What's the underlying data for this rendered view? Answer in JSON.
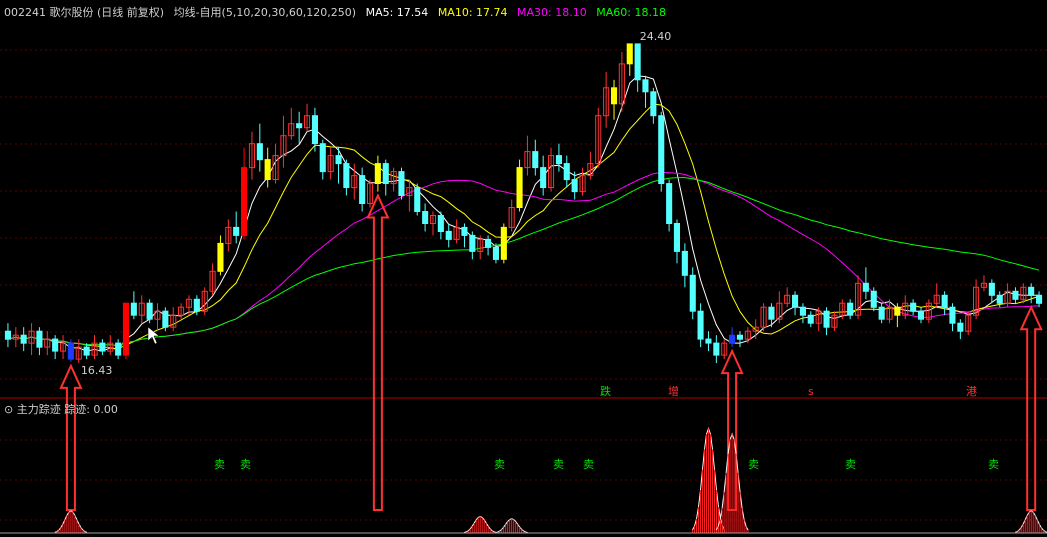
{
  "header": {
    "stock": "002241 歌尔股份 (日线 前复权)",
    "indicator": "均线-自用(5,10,20,30,60,120,250)",
    "ma5_label": "MA5: 17.54",
    "ma10_label": "MA10: 17.74",
    "ma30_label": "MA30: 18.10",
    "ma60_label": "MA60: 18.18"
  },
  "colors": {
    "background": "#000000",
    "up_candle": "#ff3232",
    "down_candle": "#54ffff",
    "signal_yellow": "#ffff00",
    "signal_red": "#ff0000",
    "signal_blue": "#1e3cff",
    "ma5": "#ffffff",
    "ma10": "#ffff00",
    "ma30": "#ff00ff",
    "ma60": "#00ff00"
  },
  "indicator_panel": {
    "title": "主力踪迹",
    "value_label": "踪迹: 0.00",
    "labels_green": [
      "卖",
      "卖",
      "卖",
      "卖",
      "卖",
      "卖",
      "卖",
      "卖"
    ],
    "labels_marks": [
      "跌",
      "增",
      "s",
      "港"
    ]
  },
  "chart_data": {
    "type": "candlestick",
    "ylim": [
      15.6,
      25.0
    ],
    "annotations": [
      {
        "text": "24.40",
        "kind": "period high",
        "value": 24.4
      },
      {
        "text": "16.43",
        "kind": "period low",
        "value": 16.43
      }
    ],
    "candles": [
      [
        17.2,
        17.0,
        17.4,
        16.8
      ],
      [
        17.0,
        17.1,
        17.3,
        16.8
      ],
      [
        17.1,
        16.9,
        17.3,
        16.7
      ],
      [
        16.9,
        17.2,
        17.4,
        16.6
      ],
      [
        17.2,
        16.8,
        17.3,
        16.6
      ],
      [
        16.8,
        17.0,
        17.2,
        16.6
      ],
      [
        17.0,
        16.7,
        17.1,
        16.5
      ],
      [
        16.7,
        16.9,
        17.1,
        16.5
      ],
      [
        16.9,
        16.5,
        17.0,
        16.43
      ],
      [
        16.5,
        16.8,
        17.0,
        16.4
      ],
      [
        16.8,
        16.6,
        16.9,
        16.5
      ],
      [
        16.6,
        16.9,
        17.1,
        16.5
      ],
      [
        16.9,
        16.7,
        17.0,
        16.6
      ],
      [
        16.7,
        16.9,
        17.1,
        16.6
      ],
      [
        16.9,
        16.6,
        17.0,
        16.5
      ],
      [
        16.6,
        17.9,
        17.9,
        16.5
      ],
      [
        17.9,
        17.6,
        18.2,
        17.5
      ],
      [
        17.6,
        17.9,
        18.1,
        17.4
      ],
      [
        17.9,
        17.5,
        18.0,
        17.4
      ],
      [
        17.5,
        17.7,
        17.9,
        17.2
      ],
      [
        17.7,
        17.3,
        17.8,
        17.2
      ],
      [
        17.3,
        17.6,
        17.8,
        17.2
      ],
      [
        17.6,
        17.8,
        17.9,
        17.5
      ],
      [
        17.8,
        18.0,
        18.1,
        17.6
      ],
      [
        18.0,
        17.7,
        18.1,
        17.6
      ],
      [
        17.7,
        18.2,
        18.3,
        17.6
      ],
      [
        18.2,
        18.7,
        18.9,
        18.1
      ],
      [
        18.7,
        19.4,
        19.6,
        18.6
      ],
      [
        19.4,
        19.8,
        20.0,
        19.2
      ],
      [
        19.8,
        19.6,
        20.2,
        19.4
      ],
      [
        19.6,
        21.3,
        21.8,
        19.5
      ],
      [
        21.3,
        21.9,
        22.2,
        21.0
      ],
      [
        21.9,
        21.5,
        22.4,
        21.2
      ],
      [
        21.5,
        21.0,
        21.8,
        20.8
      ],
      [
        21.0,
        21.6,
        21.9,
        20.9
      ],
      [
        21.6,
        22.1,
        22.6,
        21.3
      ],
      [
        22.1,
        22.4,
        22.8,
        22.0
      ],
      [
        22.4,
        22.3,
        22.7,
        21.9
      ],
      [
        22.3,
        22.6,
        22.9,
        22.2
      ],
      [
        22.6,
        21.9,
        22.8,
        21.7
      ],
      [
        21.9,
        21.2,
        22.0,
        21.0
      ],
      [
        21.2,
        21.6,
        21.8,
        21.0
      ],
      [
        21.6,
        21.4,
        21.8,
        20.9
      ],
      [
        21.4,
        20.8,
        21.5,
        20.6
      ],
      [
        20.8,
        21.1,
        21.4,
        20.5
      ],
      [
        21.1,
        20.4,
        21.3,
        20.2
      ],
      [
        20.4,
        20.9,
        21.0,
        20.3
      ],
      [
        20.9,
        21.4,
        21.6,
        20.7
      ],
      [
        21.4,
        20.9,
        21.5,
        20.6
      ],
      [
        20.9,
        21.2,
        21.3,
        20.7
      ],
      [
        21.2,
        20.6,
        21.3,
        20.5
      ],
      [
        20.6,
        20.8,
        21.0,
        20.2
      ],
      [
        20.8,
        20.2,
        20.9,
        20.1
      ],
      [
        20.2,
        19.9,
        20.4,
        19.7
      ],
      [
        19.9,
        20.1,
        20.2,
        19.6
      ],
      [
        20.1,
        19.7,
        20.2,
        19.5
      ],
      [
        19.7,
        19.5,
        19.9,
        19.3
      ],
      [
        19.5,
        19.8,
        20.0,
        19.4
      ],
      [
        19.8,
        19.6,
        19.9,
        19.3
      ],
      [
        19.6,
        19.2,
        19.7,
        19.0
      ],
      [
        19.2,
        19.5,
        19.6,
        19.0
      ],
      [
        19.5,
        19.3,
        19.6,
        19.1
      ],
      [
        19.3,
        19.0,
        19.4,
        18.9
      ],
      [
        19.0,
        19.8,
        19.9,
        18.9
      ],
      [
        19.8,
        20.3,
        20.5,
        19.7
      ],
      [
        20.3,
        21.3,
        21.5,
        20.2
      ],
      [
        21.3,
        21.7,
        22.1,
        21.1
      ],
      [
        21.7,
        21.3,
        22.0,
        21.1
      ],
      [
        21.3,
        20.8,
        21.6,
        20.6
      ],
      [
        20.8,
        21.6,
        21.8,
        20.7
      ],
      [
        21.6,
        21.4,
        21.9,
        21.2
      ],
      [
        21.4,
        21.0,
        21.6,
        20.8
      ],
      [
        21.0,
        20.7,
        21.2,
        20.5
      ],
      [
        20.7,
        21.1,
        21.3,
        20.6
      ],
      [
        21.1,
        21.4,
        21.7,
        21.0
      ],
      [
        21.4,
        22.6,
        22.8,
        21.3
      ],
      [
        22.6,
        23.3,
        23.7,
        22.3
      ],
      [
        23.3,
        22.9,
        23.5,
        22.5
      ],
      [
        22.9,
        23.9,
        24.2,
        22.7
      ],
      [
        23.9,
        24.4,
        24.4,
        23.6
      ],
      [
        24.4,
        23.5,
        24.4,
        23.2
      ],
      [
        23.5,
        23.2,
        23.6,
        22.8
      ],
      [
        23.2,
        22.6,
        23.3,
        22.4
      ],
      [
        22.6,
        20.9,
        22.7,
        20.7
      ],
      [
        20.9,
        19.9,
        21.0,
        19.7
      ],
      [
        19.9,
        19.2,
        20.0,
        18.9
      ],
      [
        19.2,
        18.6,
        19.4,
        18.3
      ],
      [
        18.6,
        17.7,
        18.8,
        17.5
      ],
      [
        17.7,
        17.0,
        17.9,
        16.8
      ],
      [
        17.0,
        16.9,
        17.2,
        16.7
      ],
      [
        16.9,
        16.6,
        17.1,
        16.4
      ],
      [
        16.6,
        16.9,
        17.0,
        16.5
      ],
      [
        16.9,
        17.1,
        17.3,
        16.8
      ],
      [
        17.1,
        17.0,
        17.2,
        16.8
      ],
      [
        17.0,
        17.2,
        17.3,
        16.9
      ],
      [
        17.2,
        17.3,
        17.5,
        17.0
      ],
      [
        17.3,
        17.8,
        17.9,
        17.2
      ],
      [
        17.8,
        17.5,
        17.9,
        17.3
      ],
      [
        17.5,
        17.9,
        18.2,
        17.4
      ],
      [
        17.9,
        18.1,
        18.3,
        17.8
      ],
      [
        18.1,
        17.8,
        18.2,
        17.6
      ],
      [
        17.8,
        17.6,
        17.9,
        17.4
      ],
      [
        17.6,
        17.4,
        17.7,
        17.3
      ],
      [
        17.4,
        17.7,
        17.8,
        17.2
      ],
      [
        17.7,
        17.3,
        17.8,
        17.1
      ],
      [
        17.3,
        17.6,
        17.7,
        17.2
      ],
      [
        17.6,
        17.9,
        18.0,
        17.5
      ],
      [
        17.9,
        17.6,
        18.0,
        17.5
      ],
      [
        17.6,
        18.4,
        18.6,
        17.5
      ],
      [
        18.4,
        18.2,
        18.8,
        18.0
      ],
      [
        18.2,
        17.8,
        18.3,
        17.7
      ],
      [
        17.8,
        17.5,
        17.9,
        17.4
      ],
      [
        17.5,
        17.8,
        18.0,
        17.4
      ],
      [
        17.8,
        17.6,
        17.9,
        17.3
      ],
      [
        17.6,
        17.9,
        18.1,
        17.5
      ],
      [
        17.9,
        17.7,
        18.0,
        17.6
      ],
      [
        17.7,
        17.5,
        17.8,
        17.4
      ],
      [
        17.5,
        17.9,
        18.0,
        17.4
      ],
      [
        17.9,
        18.1,
        18.4,
        17.8
      ],
      [
        18.1,
        17.8,
        18.2,
        17.6
      ],
      [
        17.8,
        17.4,
        17.9,
        17.2
      ],
      [
        17.4,
        17.2,
        17.5,
        17.0
      ],
      [
        17.2,
        17.6,
        17.7,
        17.1
      ],
      [
        17.6,
        18.3,
        18.5,
        17.5
      ],
      [
        18.3,
        18.4,
        18.6,
        18.2
      ],
      [
        18.4,
        18.1,
        18.5,
        17.9
      ],
      [
        18.1,
        17.9,
        18.2,
        17.8
      ],
      [
        17.9,
        18.2,
        18.4,
        17.8
      ],
      [
        18.2,
        18.0,
        18.3,
        17.9
      ],
      [
        18.0,
        18.3,
        18.4,
        17.9
      ],
      [
        18.3,
        18.1,
        18.4,
        17.9
      ],
      [
        18.1,
        17.9,
        18.2,
        17.8
      ]
    ],
    "signals": [
      {
        "index": 8,
        "color": "blue"
      },
      {
        "index": 15,
        "color": "red"
      },
      {
        "index": 27,
        "color": "yellow"
      },
      {
        "index": 30,
        "color": "red"
      },
      {
        "index": 33,
        "color": "yellow"
      },
      {
        "index": 47,
        "color": "yellow"
      },
      {
        "index": 63,
        "color": "yellow"
      },
      {
        "index": 65,
        "color": "yellow"
      },
      {
        "index": 77,
        "color": "yellow"
      },
      {
        "index": 79,
        "color": "yellow"
      },
      {
        "index": 92,
        "color": "blue"
      },
      {
        "index": 113,
        "color": "yellow"
      },
      {
        "index": 132,
        "color": "yellow"
      }
    ],
    "tracking_peaks": [
      {
        "index": 8,
        "height": 0.2
      },
      {
        "index": 60,
        "height": 0.15
      },
      {
        "index": 64,
        "height": 0.13
      },
      {
        "index": 89,
        "height": 0.95
      },
      {
        "index": 92,
        "height": 0.9
      },
      {
        "index": 130,
        "height": 0.2
      }
    ]
  }
}
